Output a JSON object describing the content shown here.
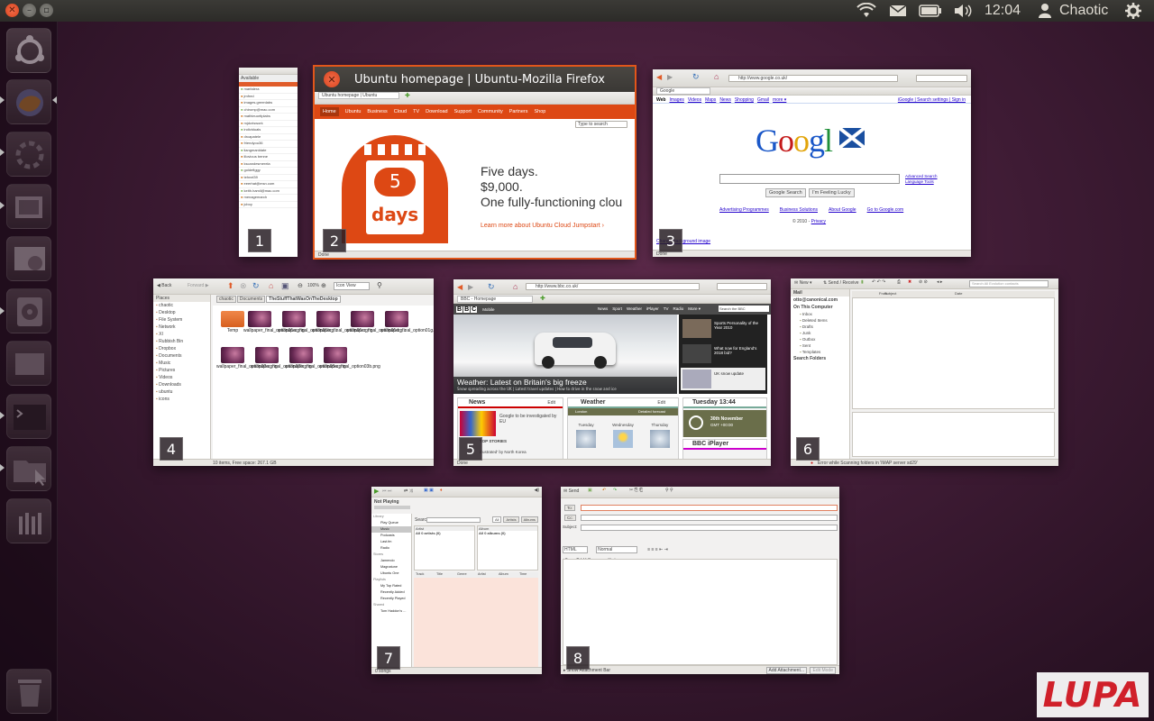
{
  "top_panel": {
    "clock": "12:04",
    "user": "Chaotic",
    "indicators": [
      "wifi-icon",
      "mail-icon",
      "battery-icon",
      "volume-icon",
      "user-icon",
      "gear-icon"
    ]
  },
  "launcher": {
    "items": [
      "ubuntu-logo",
      "firefox",
      "empathy",
      "shotwell",
      "screenshot",
      "rhythmbox",
      "banshee",
      "terminal",
      "nautilus",
      "workspace-switcher",
      "trash"
    ]
  },
  "windows": {
    "w1": {
      "number": "1",
      "status": "Available",
      "contacts": [
        "marfalera",
        "jmfred",
        "images.greenlabs",
        "chiromp@mac.com",
        "mathieuortiplabs",
        "mjdcriswork",
        "individuals",
        "drcapatele",
        "friendyou36",
        "liangmanldate",
        "illovious benne",
        "kscandesmerela",
        "goldefiggy",
        "tehnel39",
        "eeerhat@msn.com",
        "keith.hamil@mac.com",
        "menagemarch",
        "jcboy"
      ]
    },
    "w2": {
      "number": "2",
      "title": "Ubuntu homepage | Ubuntu-Mozilla Firefox",
      "tab": "Ubuntu homepage | Ubuntu",
      "nav": [
        "Home",
        "Ubuntu",
        "Business",
        "Cloud",
        "TV",
        "Download",
        "Support",
        "Community",
        "Partners",
        "Shop"
      ],
      "search_placeholder": "Type to search",
      "promo_days_number": "5",
      "promo_days_label": "days",
      "promo_line1": "Five days.",
      "promo_line2": "$9,000.",
      "promo_line3": "One fully-functioning clou",
      "promo_link": "Learn more about Ubuntu Cloud Jumpstart ›",
      "status": "Done"
    },
    "w3": {
      "number": "3",
      "url": "http://www.google.co.uk/",
      "tab": "Google",
      "links_left": [
        "Web",
        "Images",
        "Videos",
        "Maps",
        "News",
        "Shopping",
        "Gmail",
        "more ▾"
      ],
      "links_right": "iGoogle | Search settings | Sign in",
      "logo": "Google",
      "btn_search": "Google Search",
      "btn_lucky": "I'm Feeling Lucky",
      "adv_search": "Advanced Search",
      "lang_tools": "Language Tools",
      "footer_links": [
        "Advertising Programmes",
        "Business Solutions",
        "About Google",
        "Go to Google.com"
      ],
      "copyright": "© 2010 -",
      "privacy": "Privacy",
      "bg_link": "Change background image",
      "status": "Done"
    },
    "w4": {
      "number": "4",
      "back": "Back",
      "forward": "Forward",
      "zoom": "100%",
      "view": "Icon View",
      "places_label": "Places",
      "crumbs": [
        "chaotic",
        "Documents",
        "TheStuffThatWasOnTheDesktop"
      ],
      "places": [
        "chaotic",
        "Desktop",
        "File System",
        "Network",
        "XI",
        "Rubbish Bin",
        "Dropbox",
        "Documents",
        "Music",
        "Pictures",
        "Videos",
        "Downloads",
        "ubuntu",
        "icons"
      ],
      "files_row1": [
        "Temp",
        "wallpaper_final_option01a.png",
        "wallpaper_final_option01b.p...",
        "wallpaper_final_option01c.png",
        "wallpaper_final_option01d.p...",
        "wallpaper_final_option01g.p..."
      ],
      "files_row2": [
        "wallpaper_final_option02a.png",
        "wallpaper_final_option02b.png",
        "wallpaper_final_option03a.png",
        "wallpaper_final_option03b.png"
      ],
      "status": "10 items, Free space: 267.1 GB"
    },
    "w5": {
      "number": "5",
      "url": "http://www.bbc.co.uk/",
      "tab": "BBC - Homepage",
      "logo_letters": [
        "B",
        "B",
        "C"
      ],
      "mobile": "Mobile",
      "nav": [
        "News",
        "Sport",
        "Weather",
        "iPlayer",
        "TV",
        "Radio",
        "More ▾"
      ],
      "search_placeholder": "Search the BBC",
      "hero_headline": "Weather: Latest on Britain's big freeze",
      "hero_sub": "Snow spreading across the UK | Latest travel updates | How to drive in the snow and ice",
      "side_items": [
        "Sports Personality of the Year 2010",
        "What now for England's 2018 bid?",
        "UK snow update"
      ],
      "news_label": "News",
      "edit_label": "Edit",
      "news_story": "Google to be investigated by EU",
      "news_more": "Top Stories",
      "news_story2": "illustrated' by North Korea",
      "weather_label": "Weather",
      "weather_place": "London",
      "weather_detailed": "Detailed forecast",
      "weather_days": [
        "Tuesday",
        "Wednesday",
        "Thursday"
      ],
      "date_label": "Tuesday 13:44",
      "date_full": "30th November",
      "date_gmt": "GMT +00:00",
      "iplayer": "BBC iPlayer",
      "status": "Done"
    },
    "w6": {
      "number": "6",
      "new": "New",
      "send_receive": "Send / Receive",
      "search_placeholder": "Search All Evolution contacts",
      "folders_hdr": "Mail",
      "account": "otto@canonical.com",
      "local": "On This Computer",
      "folders": [
        "Inbox",
        "Deleted Items",
        "Drafts",
        "Junk",
        "Outbox",
        "Sent",
        "Templates"
      ],
      "search_folders": "Search Folders",
      "cols": [
        "From",
        "Subject",
        "Date"
      ],
      "status": "Error while Scanning folders in 'IMAP server sd29'"
    },
    "w7": {
      "number": "7",
      "now_playing": "Not Playing",
      "library_items": [
        "Library",
        "Play Queue",
        "Music",
        "Podcasts",
        "Last.fm",
        "Radio",
        "Stores",
        "Jamendo",
        "Magnatune",
        "Ubuntu One",
        "Playlists",
        "My Top Rated",
        "Recently Added",
        "Recently Played",
        "Shared",
        "Tom Haddon's ..."
      ],
      "search_label": "Search:",
      "filters": [
        "All",
        "Artists",
        "Albums"
      ],
      "artist_hdr": "Artist",
      "album_hdr": "Album",
      "artist_all": "All 0 artists (0)",
      "album_all": "All 0 albums (0)",
      "track_cols": [
        "Track",
        "Title",
        "Genre",
        "Artist",
        "Album",
        "Time"
      ],
      "status": "0 songs"
    },
    "w8": {
      "number": "8",
      "send": "Send",
      "to_label": "To:",
      "cc_label": "Cc:",
      "subject_label": "Subject:",
      "format": "HTML",
      "style": "Normal",
      "show_attach": "Show Attachment Bar",
      "add_attachment": "Add Attachment...",
      "edit_mode": "Edit Mode"
    }
  },
  "watermark": "LUPA"
}
